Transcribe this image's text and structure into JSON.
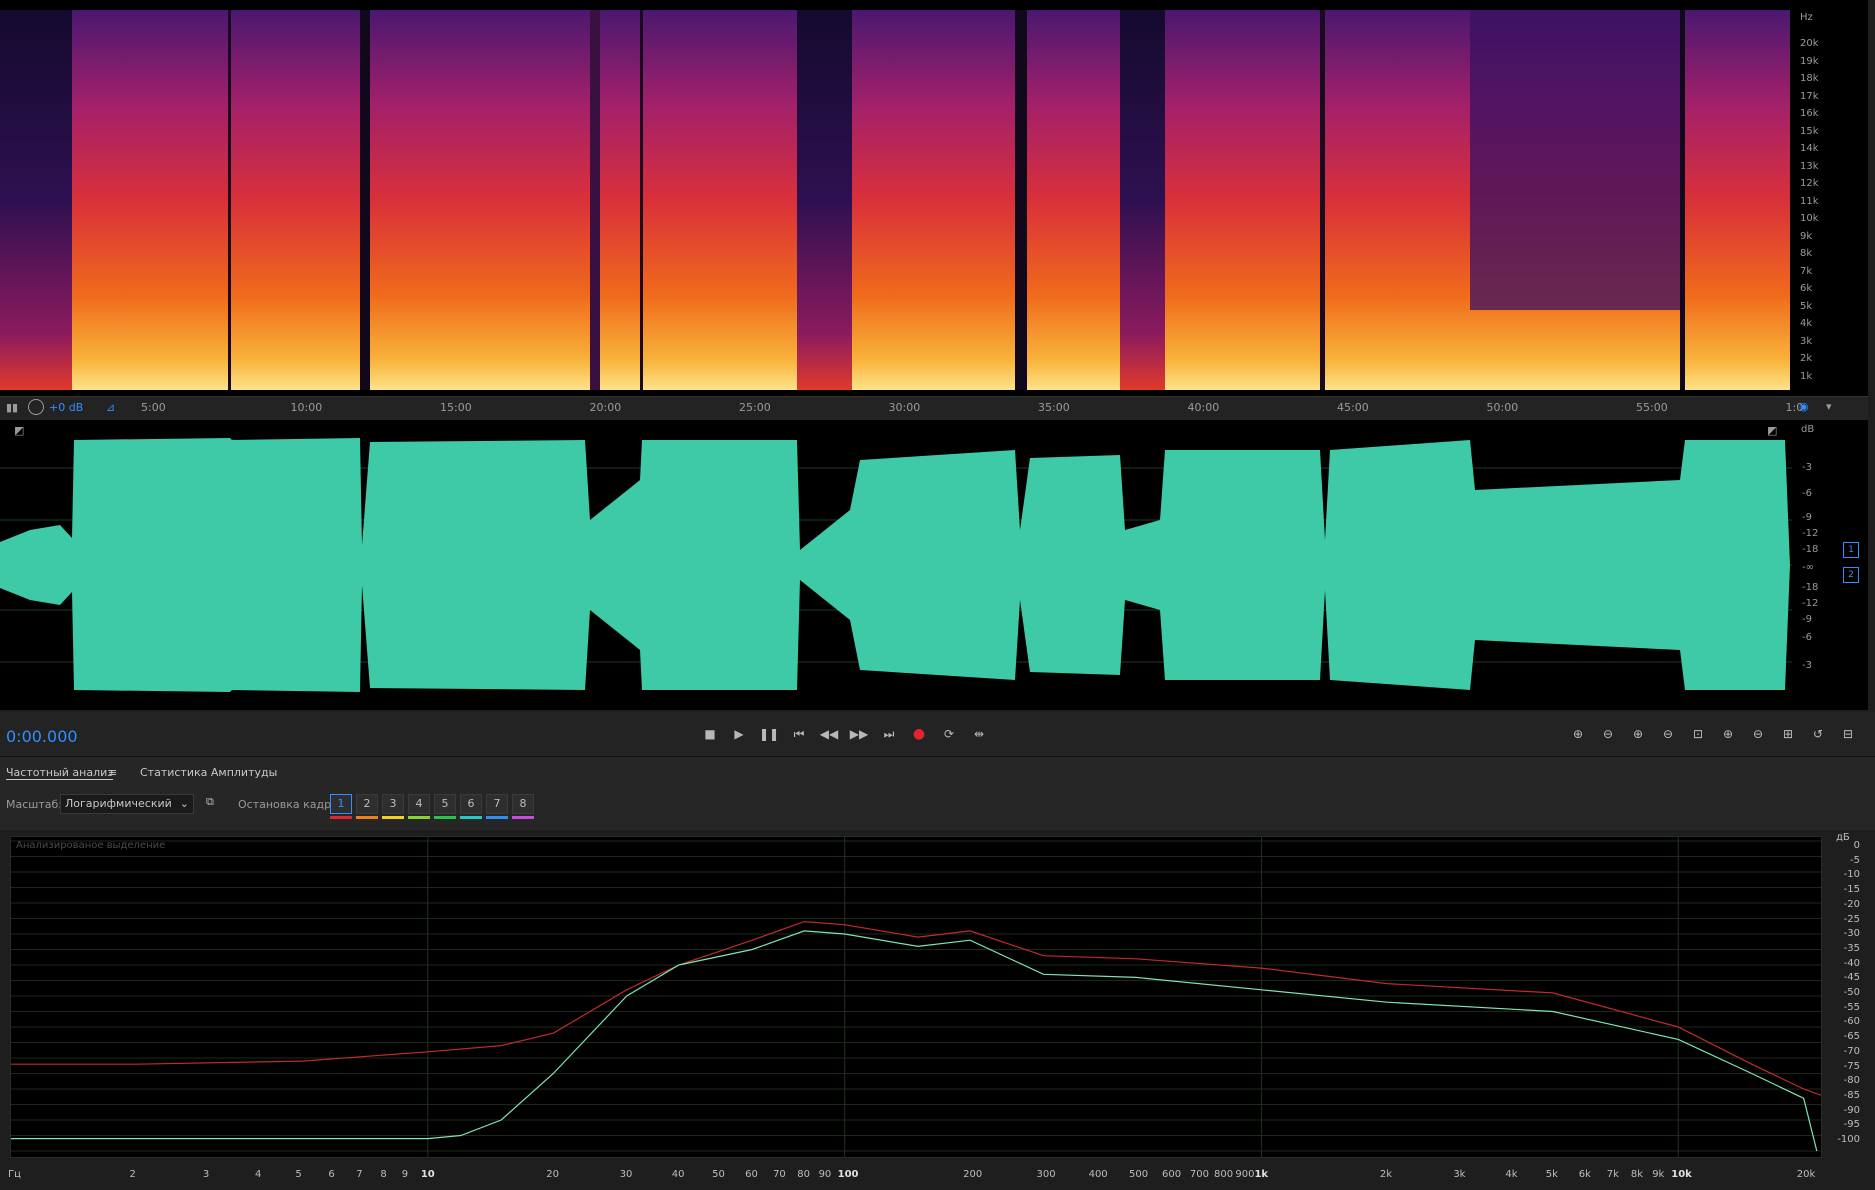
{
  "spectrogram": {
    "hz_unit": "Hz",
    "hz_labels": [
      "20k",
      "19k",
      "18k",
      "17k",
      "16k",
      "15k",
      "14k",
      "13k",
      "12k",
      "11k",
      "10k",
      "9k",
      "8k",
      "7k",
      "6k",
      "5k",
      "4k",
      "3k",
      "2k",
      "1k"
    ]
  },
  "ruler": {
    "gain": "+0 dB",
    "ticks": [
      "5:00",
      "10:00",
      "15:00",
      "20:00",
      "25:00",
      "30:00",
      "35:00",
      "40:00",
      "45:00",
      "50:00",
      "55:00",
      "1:0"
    ]
  },
  "waveform": {
    "db_unit": "dB",
    "db_labels": [
      "-3",
      "-6",
      "-9",
      "-12",
      "-18",
      "-∞",
      "-18",
      "-12",
      "-9",
      "-6",
      "-3"
    ],
    "channels": [
      "1",
      "2"
    ],
    "color": "#3ec9a7"
  },
  "transport": {
    "timecode": "0:00.000",
    "icons": [
      "stop-icon",
      "play-icon",
      "pause-icon",
      "go-to-start-icon",
      "rewind-icon",
      "fast-forward-icon",
      "go-to-end-icon",
      "record-icon",
      "loop-icon",
      "skip-selection-icon"
    ],
    "zoom_icons": [
      "zoom-in-amplitude-icon",
      "zoom-out-amplitude-icon",
      "zoom-in-time-icon",
      "zoom-out-time-icon",
      "zoom-full-icon",
      "zoom-in-point-icon",
      "zoom-out-point-icon",
      "zoom-selection-icon",
      "zoom-reset-icon",
      "zoom-tracks-icon"
    ]
  },
  "analysis": {
    "tab_frequency": "Частотный анализ",
    "tab_amplitude": "Статистика Амплитуды",
    "scale_label": "Масштаб:",
    "scale_value": "Логарифмический",
    "hold_label": "Остановка кадра:",
    "frames": [
      "1",
      "2",
      "3",
      "4",
      "5",
      "6",
      "7",
      "8"
    ],
    "frame_colors": [
      "#e0262c",
      "#f07e1e",
      "#f2d21c",
      "#8ad32a",
      "#28c44a",
      "#20c8c8",
      "#2e8ff0",
      "#c84ae0"
    ],
    "panel_caption": "Анализированое выделение",
    "db_unit": "дБ",
    "db_labels": [
      "0",
      "-5",
      "-10",
      "-15",
      "-20",
      "-25",
      "-30",
      "-35",
      "-40",
      "-45",
      "-50",
      "-55",
      "-60",
      "-65",
      "-70",
      "-75",
      "-80",
      "-85",
      "-90",
      "-95",
      "-100"
    ],
    "hz_unit": "Гц",
    "freq_labels": [
      "2",
      "3",
      "4",
      "5",
      "6",
      "7",
      "8",
      "9",
      "10",
      "20",
      "30",
      "40",
      "50",
      "60",
      "70",
      "80",
      "90",
      "100",
      "200",
      "300",
      "400",
      "500",
      "600",
      "700",
      "800",
      "900",
      "1k",
      "2k",
      "3k",
      "4k",
      "5k",
      "6k",
      "7k",
      "8k",
      "9k",
      "10k",
      "20k"
    ],
    "series_colors": {
      "red": "#c22a2a",
      "green": "#7de6b0"
    }
  },
  "chart_data": {
    "type": "line",
    "xlabel": "Гц",
    "ylabel": "дБ",
    "xscale": "log",
    "xlim": [
      1,
      22000
    ],
    "ylim": [
      -100,
      0
    ],
    "series": [
      {
        "x": [
          1,
          2,
          5,
          10,
          15,
          20,
          30,
          40,
          60,
          80,
          100,
          150,
          200,
          300,
          500,
          1000,
          2000,
          5000,
          10000,
          15000,
          20000,
          22000
        ],
        "values": [
          -72,
          -72,
          -71,
          -68,
          -66,
          -62,
          -48,
          -40,
          -32,
          -26,
          -27,
          -31,
          -29,
          -37,
          -38,
          -41,
          -46,
          -49,
          -60,
          -72,
          -80,
          -82
        ]
      },
      {
        "x": [
          1,
          2,
          5,
          10,
          12,
          15,
          20,
          30,
          40,
          60,
          80,
          100,
          150,
          200,
          300,
          500,
          1000,
          2000,
          5000,
          10000,
          15000,
          20000,
          21500
        ],
        "values": [
          -96,
          -96,
          -96,
          -96,
          -95,
          -90,
          -75,
          -50,
          -40,
          -35,
          -29,
          -30,
          -34,
          -32,
          -43,
          -44,
          -48,
          -52,
          -55,
          -64,
          -75,
          -83,
          -100
        ]
      }
    ]
  }
}
